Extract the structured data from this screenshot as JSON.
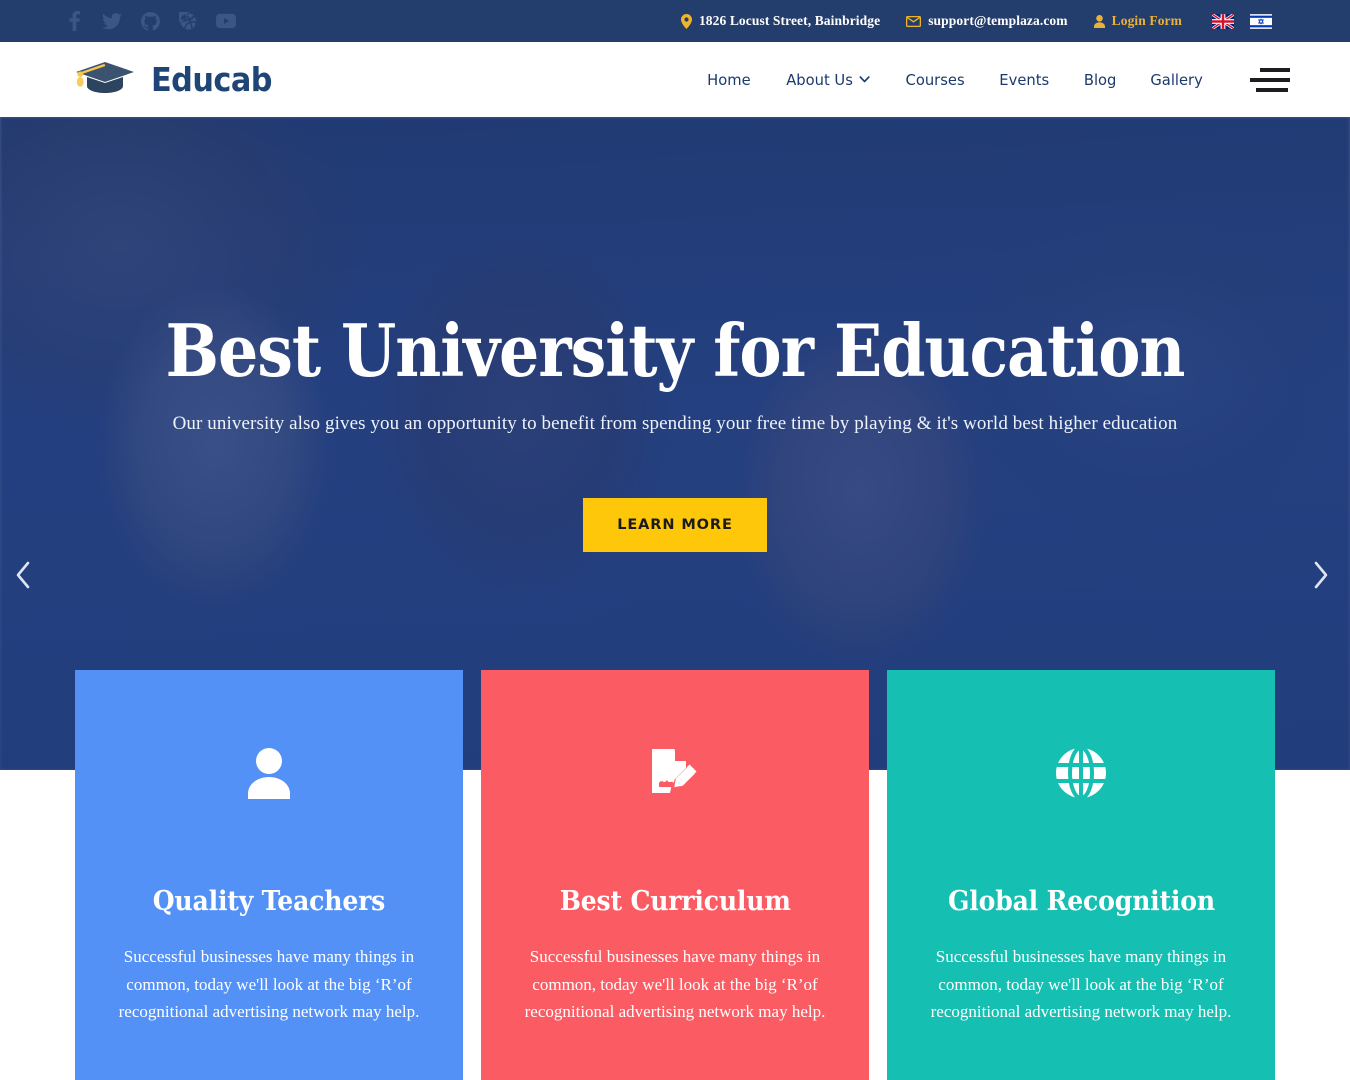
{
  "topbar": {
    "social": [
      {
        "name": "facebook-icon",
        "label": "Facebook"
      },
      {
        "name": "twitter-icon",
        "label": "Twitter"
      },
      {
        "name": "github-icon",
        "label": "GitHub"
      },
      {
        "name": "dribbble-icon",
        "label": "Dribbble"
      },
      {
        "name": "youtube-icon",
        "label": "YouTube"
      }
    ],
    "address": "1826 Locust Street, Bainbridge",
    "email": "support@templaza.com",
    "login": "Login Form",
    "flags": [
      {
        "name": "flag-united-kingdom",
        "label": "English"
      },
      {
        "name": "flag-israel",
        "label": "Hebrew"
      }
    ],
    "bg_color": "#233d6d",
    "accent_color": "#eab138"
  },
  "header": {
    "brand": "Educab",
    "brand_color": "#1f4476",
    "nav": [
      {
        "label": "Home",
        "has_dropdown": false
      },
      {
        "label": "About Us",
        "has_dropdown": true
      },
      {
        "label": "Courses",
        "has_dropdown": false
      },
      {
        "label": "Events",
        "has_dropdown": false
      },
      {
        "label": "Blog",
        "has_dropdown": false
      },
      {
        "label": "Gallery",
        "has_dropdown": false
      }
    ],
    "menu_toggle": "Menu"
  },
  "hero": {
    "title": "Best University for Education",
    "subtitle": "Our university also gives you an opportunity to benefit from spending your free time by playing & it's world best higher education",
    "cta": "LEARN MORE",
    "cta_color": "#ffc709",
    "overlay_color": "#1e3a7c",
    "prev": "Previous slide",
    "next": "Next slide"
  },
  "features": [
    {
      "icon": "user-icon",
      "title": "Quality Teachers",
      "desc": "Successful businesses have many things in common, today we'll look at the big ‘R’of recognitional advertising network may help.",
      "color": "#5491f7"
    },
    {
      "icon": "document-edit-icon",
      "title": "Best Curriculum",
      "desc": "Successful businesses have many things in common, today we'll look at the big ‘R’of recognitional advertising network may help.",
      "color": "#fb5c64"
    },
    {
      "icon": "globe-icon",
      "title": "Global Recognition",
      "desc": "Successful businesses have many things in common, today we'll look at the big ‘R’of recognitional advertising network may help.",
      "color": "#15bfb1"
    }
  ]
}
